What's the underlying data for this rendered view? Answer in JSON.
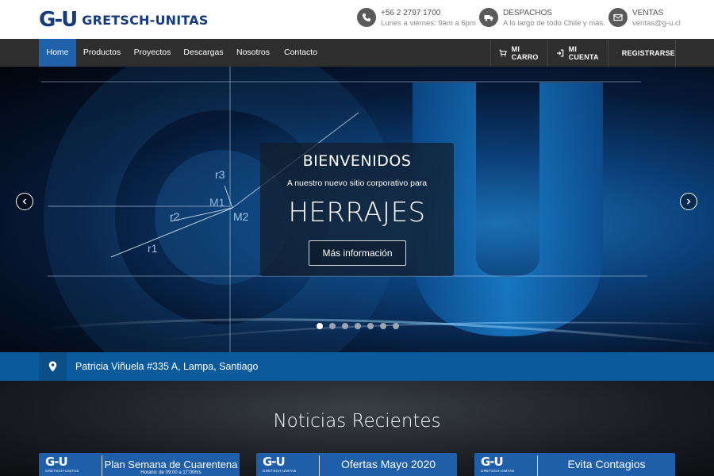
{
  "brand": {
    "logo_mark": "G-U",
    "name": "GRETSCH-UNITAS"
  },
  "contacts": [
    {
      "icon": "phone-icon",
      "line1": "+56 2 2797 1700",
      "line2": "Lunes a viernes: 9am a 6pm"
    },
    {
      "icon": "truck-icon",
      "line1": "DESPACHOS",
      "line2": "A lo largo de todo Chile y más."
    },
    {
      "icon": "mail-icon",
      "line1": "VENTAS",
      "line2": "ventas@g-u.cl"
    }
  ],
  "nav": {
    "items": [
      "Home",
      "Productos",
      "Proyectos",
      "Descargas",
      "Nosotros",
      "Contacto"
    ],
    "active": "Home",
    "right": {
      "cart": "MI CARRO",
      "account": "MI CUENTA",
      "register": "REGISTRARSE"
    }
  },
  "hero": {
    "title": "BIENVENIDOS",
    "subtitle": "A nuestro nuevo sitio corporativo para",
    "headline": "HERRAJES",
    "button": "Más información",
    "slide_count": 7,
    "active_slide": 1,
    "diagram_labels": [
      "r3",
      "M1",
      "M2",
      "r2",
      "r1"
    ]
  },
  "address": {
    "text": "Patricia Viñuela #335 A, Lampa, Santiago"
  },
  "news": {
    "title": "Noticias Recientes",
    "cards": [
      {
        "logo": "G-U",
        "logo_sub": "GRETSCH-UNITAS",
        "title": "Plan Semana de Cuarentena",
        "meta": "Horario: de 09:00 a 17:00hrs"
      },
      {
        "logo": "G-U",
        "logo_sub": "GRETSCH-UNITAS",
        "title": "Ofertas Mayo 2020",
        "meta": ""
      },
      {
        "logo": "G-U",
        "logo_sub": "GRETSCH-UNITAS",
        "title": "Evita Contagios",
        "meta": ""
      }
    ]
  },
  "colors": {
    "brand_blue": "#173a78",
    "nav_bg": "#2e2e2e",
    "nav_active": "#1f62ab",
    "address_bar": "#0b5a9c",
    "card_blue": "#1f5ea8"
  }
}
